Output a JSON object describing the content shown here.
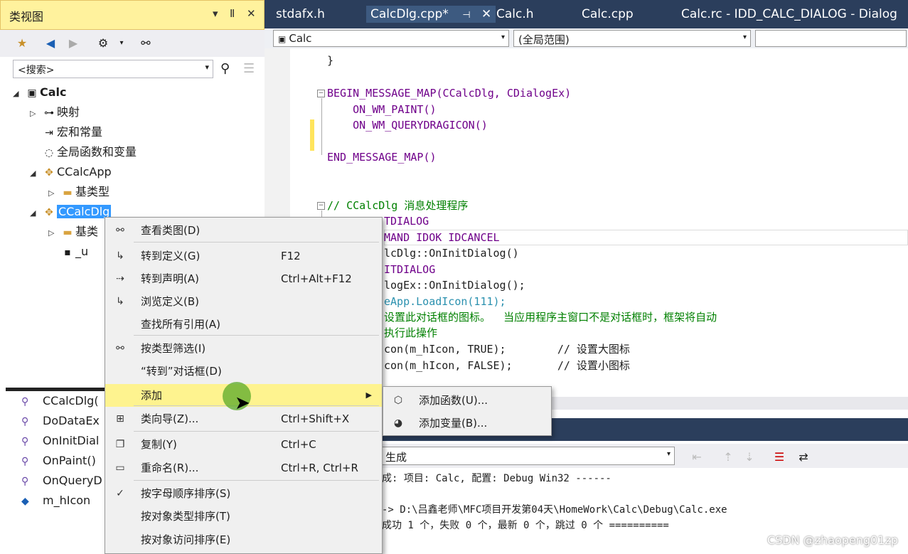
{
  "classview": {
    "title": "类视图",
    "title_buttons": [
      "▾",
      "Ⅱ",
      "✕"
    ],
    "search_placeholder": "<搜索>",
    "tree": [
      {
        "label": "Calc",
        "icon": "project-icon",
        "arrow": "◢",
        "bold": true
      },
      {
        "label": "映射",
        "icon": "key-icon",
        "arrow": "▷"
      },
      {
        "label": "宏和常量",
        "icon": "macro-icon",
        "arrow": ""
      },
      {
        "label": "全局函数和变量",
        "icon": "globe-icon",
        "arrow": ""
      },
      {
        "label": "CCalcApp",
        "icon": "class-icon",
        "arrow": "◢"
      },
      {
        "label": "基类型",
        "icon": "folder-icon",
        "arrow": "▷"
      },
      {
        "label": "CCalcDlg",
        "icon": "class-icon",
        "arrow": "◢",
        "selected": true
      },
      {
        "label": "基类",
        "icon": "folder-icon",
        "arrow": "▷"
      },
      {
        "label": "_u",
        "icon": "var-icon",
        "arrow": ""
      }
    ],
    "members": [
      {
        "label": "CCalcDlg(",
        "icon": "method-icon"
      },
      {
        "label": "DoDataEx",
        "icon": "method-icon"
      },
      {
        "label": "OnInitDial",
        "icon": "method-icon"
      },
      {
        "label": "OnPaint()",
        "icon": "method-icon"
      },
      {
        "label": "OnQueryD",
        "icon": "method-icon"
      },
      {
        "label": "m_hIcon",
        "icon": "field-icon"
      }
    ]
  },
  "editor": {
    "tabs": [
      "stdafx.h",
      "CalcDlg.cpp*",
      "Calc.h",
      "Calc.cpp",
      "Calc.rc - IDD_CALC_DIALOG - Dialog"
    ],
    "active_tab": 1,
    "pin": "⊣",
    "close": "✕",
    "nav_left": "Calc",
    "nav_right": "(全局范围)",
    "lines": [
      {
        "t": "}",
        "c": ""
      },
      {
        "t": "BEGIN_MESSAGE_MAP(CCalcDlg, CDialogEx)",
        "c": "mac"
      },
      {
        "t": "    ON_WM_PAINT()",
        "c": "mac"
      },
      {
        "t": "    ON_WM_QUERYDRAGICON()",
        "c": "mac"
      },
      {
        "t": "END_MESSAGE_MAP()",
        "c": "mac"
      },
      {
        "t": "// CCalcDlg 消息处理程序",
        "c": "cmt"
      },
      {
        "t": "TDIALOG",
        "c": "mac"
      },
      {
        "t": "MAND IDOK IDCANCEL",
        "c": "mac"
      },
      {
        "t": "lcDlg::OnInitDialog()",
        "c": ""
      },
      {
        "t": "ITDIALOG",
        "c": "mac"
      },
      {
        "t": "logEx::OnInitDialog();",
        "c": ""
      },
      {
        "t": "eApp.LoadIcon(111);",
        "c": "typ"
      },
      {
        "t": "设置此对话框的图标。  当应用程序主窗口不是对话框时，框架将自动",
        "c": "cmt"
      },
      {
        "t": "执行此操作",
        "c": "cmt"
      },
      {
        "t": "con(m_hIcon, TRUE);        // 设置大图标",
        "c": ""
      },
      {
        "t": "con(m_hIcon, FALSE);       // 设置小图标",
        "c": ""
      }
    ]
  },
  "output": {
    "combo": "生成",
    "lines": [
      "成: 项目: Calc, 配置: Debug Win32 ------",
      "",
      "-> D:\\吕鑫老师\\MFC项目开发第04天\\HomeWork\\Calc\\Debug\\Calc.exe",
      "成功 1 个，失败 0 个，最新 0 个，跳过 0 个 =========="
    ]
  },
  "context_menu": {
    "items": [
      {
        "label": "查看类图(D)",
        "shortcut": "",
        "icon": "class-diagram-icon"
      },
      {
        "label": "转到定义(G)",
        "shortcut": "F12",
        "icon": "goto-definition-icon"
      },
      {
        "label": "转到声明(A)",
        "shortcut": "Ctrl+Alt+F12",
        "icon": "goto-declaration-icon"
      },
      {
        "label": "浏览定义(B)",
        "shortcut": "",
        "icon": "browse-definition-icon"
      },
      {
        "label": "查找所有引用(A)",
        "shortcut": "",
        "icon": ""
      },
      {
        "label": "按类型筛选(I)",
        "shortcut": "",
        "icon": "filter-icon"
      },
      {
        "label": "“转到”对话框(D)",
        "shortcut": "",
        "icon": ""
      },
      {
        "label": "添加",
        "shortcut": "",
        "icon": "",
        "submenu": true,
        "highlighted": true
      },
      {
        "label": "类向导(Z)...",
        "shortcut": "Ctrl+Shift+X",
        "icon": "class-wizard-icon"
      },
      {
        "label": "复制(Y)",
        "shortcut": "Ctrl+C",
        "icon": "copy-icon"
      },
      {
        "label": "重命名(R)...",
        "shortcut": "Ctrl+R, Ctrl+R",
        "icon": "rename-icon"
      },
      {
        "label": "按字母顺序排序(S)",
        "shortcut": "",
        "icon": "check-icon"
      },
      {
        "label": "按对象类型排序(T)",
        "shortcut": "",
        "icon": ""
      },
      {
        "label": "按对象访问排序(E)",
        "shortcut": "",
        "icon": ""
      }
    ],
    "submenu": [
      {
        "label": "添加函数(U)...",
        "icon": "add-function-icon"
      },
      {
        "label": "添加变量(B)...",
        "icon": "add-variable-icon"
      }
    ]
  },
  "watermark": "CSDN @zhaopeng01zp"
}
